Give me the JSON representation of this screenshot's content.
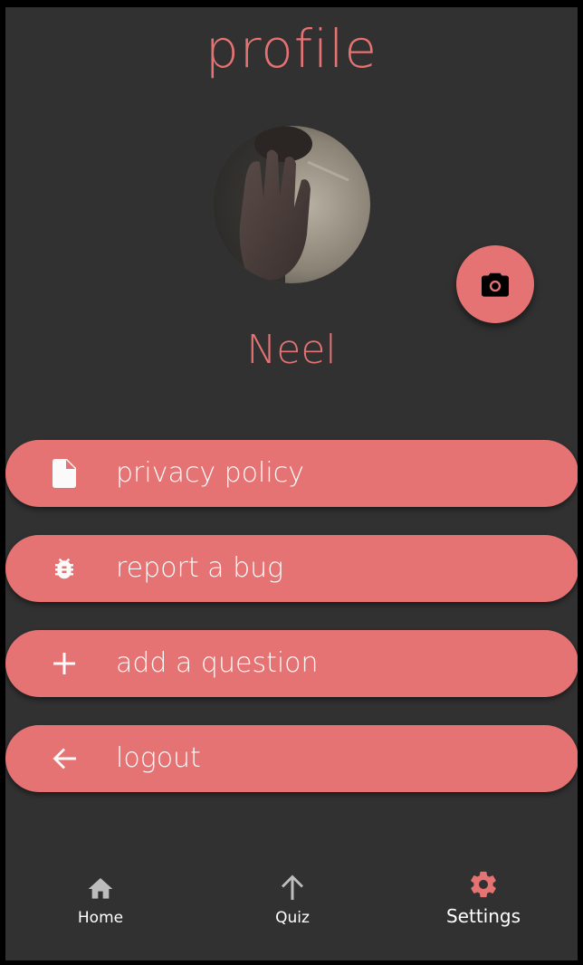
{
  "page": {
    "title": "profile"
  },
  "profile": {
    "name": "Neel"
  },
  "menu": [
    {
      "label": "privacy policy",
      "icon": "document-icon"
    },
    {
      "label": "report a bug",
      "icon": "bug-icon"
    },
    {
      "label": "add a question",
      "icon": "plus-icon"
    },
    {
      "label": "logout",
      "icon": "arrow-left-icon"
    }
  ],
  "bottom_nav": {
    "items": [
      {
        "label": "Home",
        "icon": "home-icon",
        "active": false
      },
      {
        "label": "Quiz",
        "icon": "arrow-up-icon",
        "active": false
      },
      {
        "label": "Settings",
        "icon": "gear-icon",
        "active": true
      }
    ]
  },
  "colors": {
    "accent": "#e57373",
    "background": "#313131",
    "inactive_icon": "#bdbdbd"
  }
}
